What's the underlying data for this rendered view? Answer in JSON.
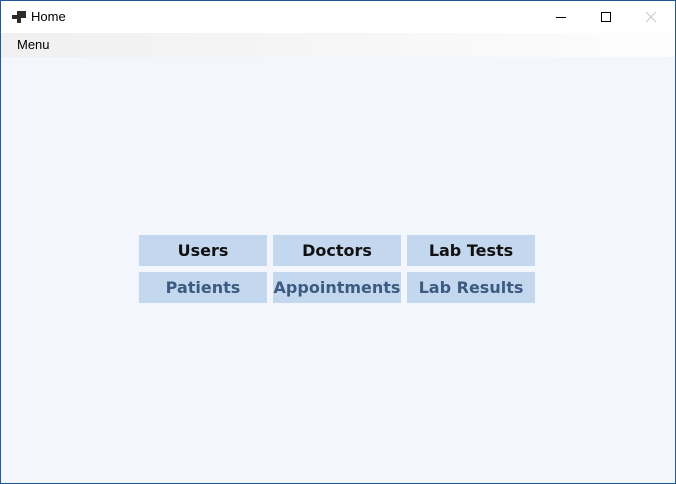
{
  "window": {
    "title": "Home",
    "accent_color": "#1f5a96"
  },
  "title_bar": {
    "icon": "app-window-icon",
    "controls": [
      "minimize-icon",
      "maximize-icon",
      "close-icon"
    ]
  },
  "menu": {
    "items": [
      {
        "label": "Menu"
      }
    ]
  },
  "tiles": {
    "users": {
      "label": "Users",
      "state": "enabled"
    },
    "doctors": {
      "label": "Doctors",
      "state": "enabled"
    },
    "lab_tests": {
      "label": "Lab Tests",
      "state": "enabled"
    },
    "patients": {
      "label": "Patients",
      "state": "muted"
    },
    "appointments": {
      "label": "Appointments",
      "state": "muted"
    },
    "lab_results": {
      "label": "Lab Results",
      "state": "muted"
    }
  },
  "colors": {
    "tile_background": "#c3d8ee",
    "client_background": "#f3f7fd",
    "tile_text_dark": "#111111",
    "tile_text_muted": "#3d5a82"
  }
}
